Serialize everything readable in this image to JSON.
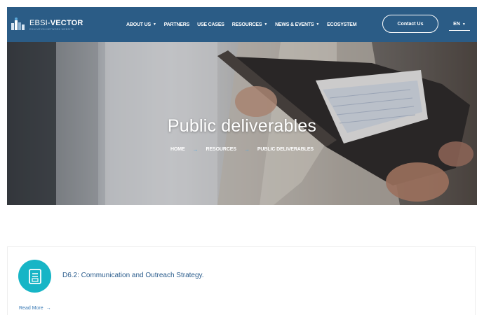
{
  "header": {
    "logo": {
      "prefix": "EBSI-",
      "name": "VECTOR",
      "tagline": "EDUCATION NETWORK WEBSITE"
    },
    "nav": [
      {
        "label": "ABOUT US",
        "has_dropdown": true
      },
      {
        "label": "PARTNERS",
        "has_dropdown": false
      },
      {
        "label": "USE CASES",
        "has_dropdown": false
      },
      {
        "label": "RESOURCES",
        "has_dropdown": true
      },
      {
        "label": "NEWS & EVENTS",
        "has_dropdown": true
      },
      {
        "label": "ECOSYSTEM",
        "has_dropdown": false
      }
    ],
    "caret": "▼",
    "contact_label": "Contact Us",
    "language": "EN",
    "colors": {
      "header_bg": "#2b5c86",
      "accent": "#17b5c6"
    }
  },
  "hero": {
    "title": "Public deliverables",
    "breadcrumb": {
      "home": "HOME",
      "resources": "RESOURCES",
      "current": "PUBLIC DELIVERABLES",
      "separator": "→"
    }
  },
  "deliverable": {
    "icon": "document-icon",
    "title": "D6.2: Communication and Outreach Strategy.",
    "read_more": "Read More",
    "arrow": "→"
  }
}
